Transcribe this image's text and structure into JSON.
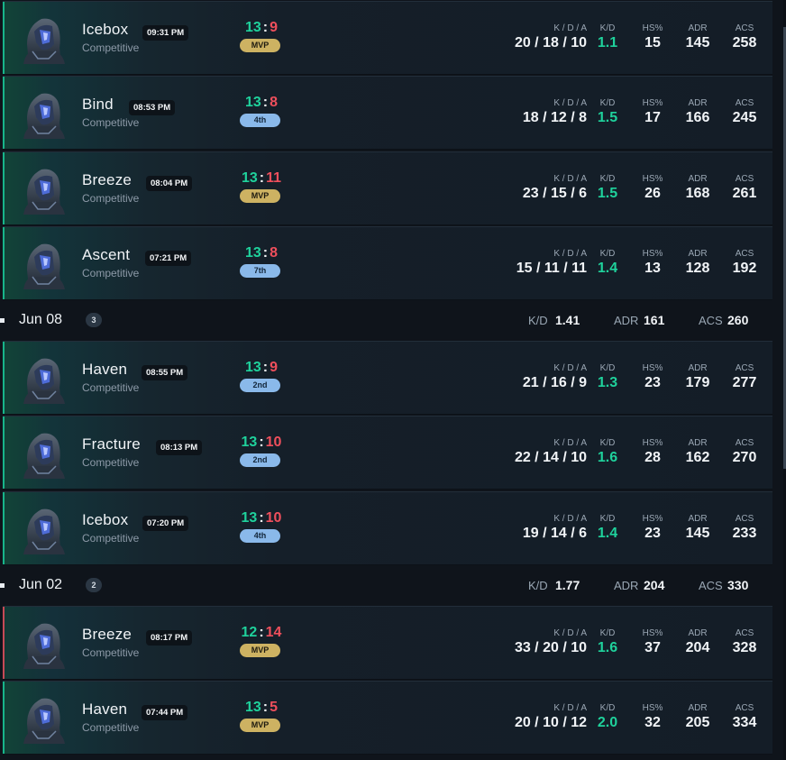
{
  "matches_top": [
    {
      "map": "Icebox",
      "time": "09:31 PM",
      "mode": "Competitive",
      "score_w": "13",
      "score_l": "9",
      "badge": "MVP",
      "badge_type": "mvp",
      "kda": "20 / 18 / 10",
      "kd": "1.1",
      "hs": "15",
      "adr": "145",
      "acs": "258",
      "result": "win"
    },
    {
      "map": "Bind",
      "time": "08:53 PM",
      "mode": "Competitive",
      "score_w": "13",
      "score_l": "8",
      "badge": "4th",
      "badge_type": "place",
      "kda": "18 / 12 / 8",
      "kd": "1.5",
      "hs": "17",
      "adr": "166",
      "acs": "245",
      "result": "win"
    },
    {
      "map": "Breeze",
      "time": "08:04 PM",
      "mode": "Competitive",
      "score_w": "13",
      "score_l": "11",
      "badge": "MVP",
      "badge_type": "mvp",
      "kda": "23 / 15 / 6",
      "kd": "1.5",
      "hs": "26",
      "adr": "168",
      "acs": "261",
      "result": "win"
    },
    {
      "map": "Ascent",
      "time": "07:21 PM",
      "mode": "Competitive",
      "score_w": "13",
      "score_l": "8",
      "badge": "7th",
      "badge_type": "place",
      "kda": "15 / 11 / 11",
      "kd": "1.4",
      "hs": "13",
      "adr": "128",
      "acs": "192",
      "result": "win"
    }
  ],
  "day1": {
    "date": "Jun 08",
    "count": "3",
    "kd_label": "K/D",
    "kd": "1.41",
    "adr_label": "ADR",
    "adr": "161",
    "acs_label": "ACS",
    "acs": "260"
  },
  "matches_mid": [
    {
      "map": "Haven",
      "time": "08:55 PM",
      "mode": "Competitive",
      "score_w": "13",
      "score_l": "9",
      "badge": "2nd",
      "badge_type": "place",
      "kda": "21 / 16 / 9",
      "kd": "1.3",
      "hs": "23",
      "adr": "179",
      "acs": "277",
      "result": "win"
    },
    {
      "map": "Fracture",
      "time": "08:13 PM",
      "mode": "Competitive",
      "score_w": "13",
      "score_l": "10",
      "badge": "2nd",
      "badge_type": "place",
      "kda": "22 / 14 / 10",
      "kd": "1.6",
      "hs": "28",
      "adr": "162",
      "acs": "270",
      "result": "win"
    },
    {
      "map": "Icebox",
      "time": "07:20 PM",
      "mode": "Competitive",
      "score_w": "13",
      "score_l": "10",
      "badge": "4th",
      "badge_type": "place",
      "kda": "19 / 14 / 6",
      "kd": "1.4",
      "hs": "23",
      "adr": "145",
      "acs": "233",
      "result": "win"
    }
  ],
  "day2": {
    "date": "Jun 02",
    "count": "2",
    "kd_label": "K/D",
    "kd": "1.77",
    "adr_label": "ADR",
    "adr": "204",
    "acs_label": "ACS",
    "acs": "330"
  },
  "matches_bot": [
    {
      "map": "Breeze",
      "time": "08:17 PM",
      "mode": "Competitive",
      "score_w": "12",
      "score_l": "14",
      "badge": "MVP",
      "badge_type": "mvp",
      "kda": "33 / 20 / 10",
      "kd": "1.6",
      "hs": "37",
      "adr": "204",
      "acs": "328",
      "result": "loss"
    },
    {
      "map": "Haven",
      "time": "07:44 PM",
      "mode": "Competitive",
      "score_w": "13",
      "score_l": "5",
      "badge": "MVP",
      "badge_type": "mvp",
      "kda": "20 / 10 / 12",
      "kd": "2.0",
      "hs": "32",
      "adr": "205",
      "acs": "334",
      "result": "win"
    }
  ],
  "labels": {
    "kda": "K / D / A",
    "kd": "K/D",
    "hs": "HS%",
    "adr": "ADR",
    "acs": "ACS"
  },
  "colors": {
    "win": "#1fd29c",
    "loss": "#ef4f5c",
    "mvp": "#cdb262",
    "place": "#8ab9ea"
  },
  "icons": {
    "agent": "agent-portrait-icon"
  }
}
